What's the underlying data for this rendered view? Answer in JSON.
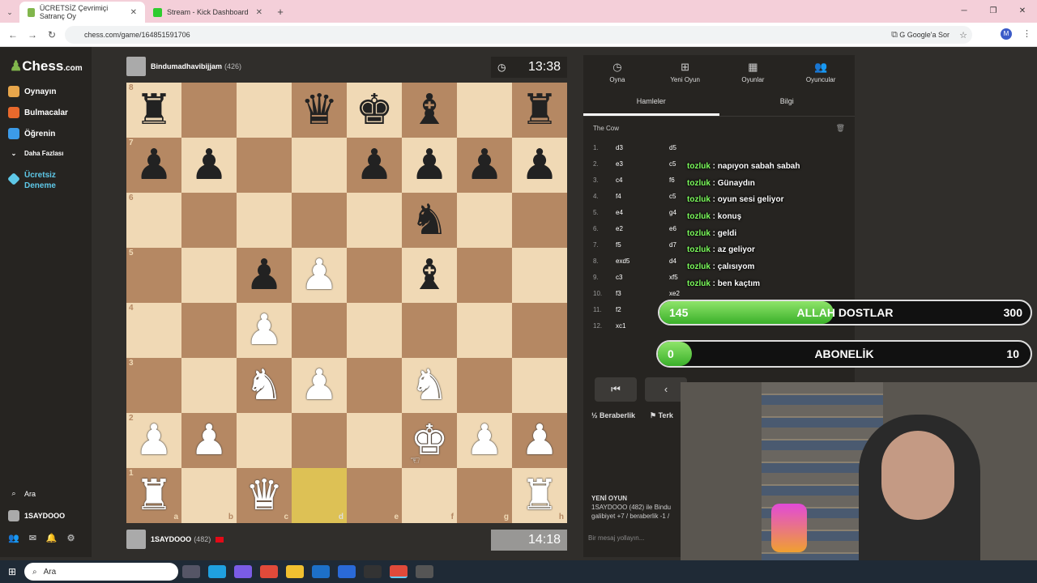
{
  "browser": {
    "tabs": [
      {
        "label": "ÜCRETSİZ Çevrimiçi Satranç Oy",
        "active": true,
        "favicon_color": "#81b64c"
      },
      {
        "label": "Stream - Kick Dashboard",
        "active": false,
        "favicon_color": "#2ecc2e"
      }
    ],
    "url": "chess.com/game/164851591706",
    "google_label": "Google'a Sor",
    "profile_initial": "M"
  },
  "sidebar": {
    "logo_main": "Chess",
    "logo_suffix": ".com",
    "items": [
      {
        "label": "Oynayın",
        "color": "#e8a64b"
      },
      {
        "label": "Bulmacalar",
        "color": "#e9692c"
      },
      {
        "label": "Öğrenin",
        "color": "#3c9be8"
      },
      {
        "label": "Daha Fazlası",
        "color": "#888888"
      },
      {
        "label": "Ücretsiz Deneme",
        "color": "#5ec8e8"
      }
    ],
    "search_label": "Ara",
    "user_label": "1SAYDOOO"
  },
  "game": {
    "top_player": {
      "name": "Bindumadhavibijjam",
      "rating": "(426)",
      "clock": "13:38"
    },
    "bottom_player": {
      "name": "1SAYDOOO",
      "rating": "(482)",
      "clock": "14:18"
    },
    "board": [
      [
        "br",
        "",
        "",
        "bq",
        "bk",
        "bb",
        "",
        "br"
      ],
      [
        "bp",
        "bp",
        "",
        "",
        "bp",
        "bp",
        "bp",
        "bp"
      ],
      [
        "",
        "",
        "",
        "",
        "",
        "bn",
        "",
        ""
      ],
      [
        "",
        "",
        "bp",
        "wp",
        "",
        "bb",
        "",
        ""
      ],
      [
        "",
        "",
        "wp",
        "",
        "",
        "",
        "",
        ""
      ],
      [
        "",
        "",
        "wn",
        "wp",
        "",
        "wn",
        "",
        ""
      ],
      [
        "wp",
        "wp",
        "",
        "",
        "",
        "wk",
        "wp",
        "wp"
      ],
      [
        "wr",
        "",
        "wq",
        "",
        "",
        "",
        "",
        "wr"
      ]
    ],
    "highlight": [
      [
        7,
        3
      ]
    ],
    "files": [
      "a",
      "b",
      "c",
      "d",
      "e",
      "f",
      "g",
      "h"
    ],
    "ranks": [
      "8",
      "7",
      "6",
      "5",
      "4",
      "3",
      "2",
      "1"
    ]
  },
  "panel": {
    "top_tabs": [
      {
        "label": "Oyna",
        "icon": "clock-icon"
      },
      {
        "label": "Yeni Oyun",
        "icon": "plus-icon"
      },
      {
        "label": "Oyunlar",
        "icon": "grid-icon"
      },
      {
        "label": "Oyuncular",
        "icon": "people-icon"
      }
    ],
    "sub_tabs": [
      "Hamleler",
      "Bilgi"
    ],
    "opening": "The Cow",
    "moves": [
      {
        "n": "1.",
        "w": "d3",
        "b": "d5"
      },
      {
        "n": "2.",
        "w": "e3",
        "b": "c5"
      },
      {
        "n": "3.",
        "w": "c4",
        "b": "f6"
      },
      {
        "n": "4.",
        "w": "f4",
        "b": "c5"
      },
      {
        "n": "5.",
        "w": "e4",
        "b": "g4"
      },
      {
        "n": "6.",
        "w": "e2",
        "b": "e6"
      },
      {
        "n": "7.",
        "w": "f5",
        "b": "d7"
      },
      {
        "n": "8.",
        "w": "exd5",
        "b": "d4"
      },
      {
        "n": "9.",
        "w": "c3",
        "b": "xf5"
      },
      {
        "n": "10.",
        "w": "f3",
        "b": "xe2"
      },
      {
        "n": "11.",
        "w": "f2",
        "b": ""
      },
      {
        "n": "12.",
        "w": "xc1",
        "b": ""
      }
    ],
    "draw_label": "Beraberlik",
    "resign_label": "Terk",
    "new_game_title": "YENİ OYUN",
    "new_game_text": "1SAYDOOO (482) ile Bindu",
    "new_game_text2": "galibiyet +7 / beraberlik -1 /",
    "message_placeholder": "Bir mesaj yollayın..."
  },
  "chat": [
    {
      "user": "tozluk",
      "msg": ": napıyon sabah sabah"
    },
    {
      "user": "tozluk",
      "msg": ": Günaydın"
    },
    {
      "user": "tozluk",
      "msg": ": oyun sesi geliyor"
    },
    {
      "user": "tozluk",
      "msg": ": konuş"
    },
    {
      "user": "tozluk",
      "msg": ": geldi"
    },
    {
      "user": "tozluk",
      "msg": ": az geliyor"
    },
    {
      "user": "tozluk",
      "msg": ": çalısıyom"
    },
    {
      "user": "tozluk",
      "msg": ": ben kaçtım"
    }
  ],
  "goals": [
    {
      "current": "145",
      "title": "ALLAH DOSTLAR",
      "target": "300",
      "fraction": 0.48
    },
    {
      "current": "0",
      "title": "ABONELİK",
      "target": "10",
      "fraction": 0.0
    }
  ],
  "taskbar": {
    "search_label": "Ara"
  }
}
